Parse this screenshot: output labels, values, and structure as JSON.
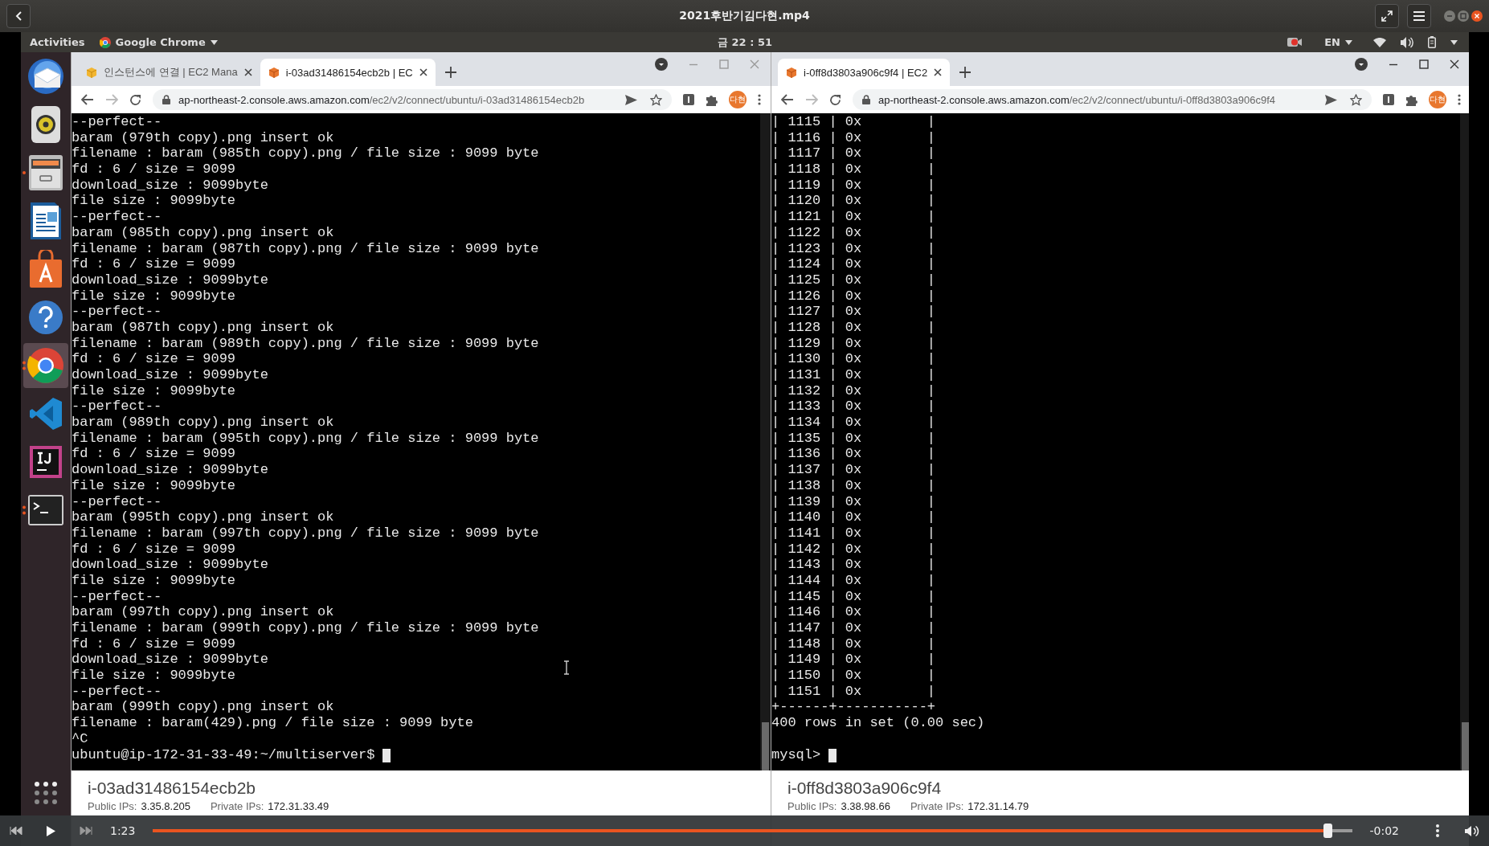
{
  "player": {
    "title": "2021후반기김다현.mp4",
    "elapsed": "1:23",
    "remaining": "-0:02",
    "progress": {
      "level": 0.98
    }
  },
  "topbar": {
    "activities": "Activities",
    "app": "Google Chrome",
    "clock": "금 22 : 51",
    "language": "EN"
  },
  "dock": [
    {
      "kind": "mail",
      "running": false,
      "selected": false
    },
    {
      "kind": "speaker",
      "running": false,
      "selected": false
    },
    {
      "kind": "files",
      "running": true,
      "multiple": false,
      "selected": false
    },
    {
      "kind": "writer",
      "running": false,
      "selected": false
    },
    {
      "kind": "store",
      "running": false,
      "selected": false
    },
    {
      "kind": "help",
      "running": false,
      "selected": false
    },
    {
      "kind": "browser",
      "running": true,
      "multiple": true,
      "selected": true
    },
    {
      "kind": "code",
      "running": false,
      "selected": false
    },
    {
      "kind": "ide",
      "running": false,
      "selected": false
    },
    {
      "kind": "terminal",
      "running": true,
      "multiple": true,
      "selected": false
    },
    {
      "kind": "apps",
      "running": false,
      "selected": false
    }
  ],
  "windows": [
    {
      "active": false,
      "tabs": [
        {
          "title": "인스턴스에 연결 | EC2 Mana",
          "kind": "console",
          "selected": false
        },
        {
          "title": "i-03ad31486154ecb2b | EC",
          "kind": "instance",
          "selected": true
        }
      ],
      "url_host": "ap-northeast-2.console.aws.amazon.com",
      "url_path": "/ec2/v2/connect/ubuntu/i-03ad31486154ecb2b",
      "avatar": "다현",
      "terminal": {
        "lines": [
          "--perfect--",
          "baram (979th copy).png insert ok",
          "filename : baram (985th copy).png / file size : 9099 byte",
          "fd : 6 / size = 9099",
          "download_size : 9099byte",
          "file size : 9099byte",
          "--perfect--",
          "baram (985th copy).png insert ok",
          "filename : baram (987th copy).png / file size : 9099 byte",
          "fd : 6 / size = 9099",
          "download_size : 9099byte",
          "file size : 9099byte",
          "--perfect--",
          "baram (987th copy).png insert ok",
          "filename : baram (989th copy).png / file size : 9099 byte",
          "fd : 6 / size = 9099",
          "download_size : 9099byte",
          "file size : 9099byte",
          "--perfect--",
          "baram (989th copy).png insert ok",
          "filename : baram (995th copy).png / file size : 9099 byte",
          "fd : 6 / size = 9099",
          "download_size : 9099byte",
          "file size : 9099byte",
          "--perfect--",
          "baram (995th copy).png insert ok",
          "filename : baram (997th copy).png / file size : 9099 byte",
          "fd : 6 / size = 9099",
          "download_size : 9099byte",
          "file size : 9099byte",
          "--perfect--",
          "baram (997th copy).png insert ok",
          "filename : baram (999th copy).png / file size : 9099 byte",
          "fd : 6 / size = 9099",
          "download_size : 9099byte",
          "file size : 9099byte",
          "--perfect--",
          "baram (999th copy).png insert ok",
          "filename : baram(429).png / file size : 9099 byte",
          "^C"
        ],
        "prompt": "ubuntu@ip-172-31-33-49:~/multiserver$"
      },
      "instance_id": "i-03ad31486154ecb2b",
      "public_label": "Public IPs:",
      "public_ip": "3.35.8.205",
      "private_label": "Private IPs:",
      "private_ip": "172.31.33.49"
    },
    {
      "active": true,
      "tabs": [
        {
          "title": "i-0ff8d3803a906c9f4 | EC2",
          "kind": "instance",
          "selected": true
        }
      ],
      "url_host": "ap-northeast-2.console.aws.amazon.com",
      "url_path": "/ec2/v2/connect/ubuntu/i-0ff8d3803a906c9f4",
      "avatar": "다현",
      "terminal": {
        "lines": [
          "| 1115 | 0x        |",
          "| 1116 | 0x        |",
          "| 1117 | 0x        |",
          "| 1118 | 0x        |",
          "| 1119 | 0x        |",
          "| 1120 | 0x        |",
          "| 1121 | 0x        |",
          "| 1122 | 0x        |",
          "| 1123 | 0x        |",
          "| 1124 | 0x        |",
          "| 1125 | 0x        |",
          "| 1126 | 0x        |",
          "| 1127 | 0x        |",
          "| 1128 | 0x        |",
          "| 1129 | 0x        |",
          "| 1130 | 0x        |",
          "| 1131 | 0x        |",
          "| 1132 | 0x        |",
          "| 1133 | 0x        |",
          "| 1134 | 0x        |",
          "| 1135 | 0x        |",
          "| 1136 | 0x        |",
          "| 1137 | 0x        |",
          "| 1138 | 0x        |",
          "| 1139 | 0x        |",
          "| 1140 | 0x        |",
          "| 1141 | 0x        |",
          "| 1142 | 0x        |",
          "| 1143 | 0x        |",
          "| 1144 | 0x        |",
          "| 1145 | 0x        |",
          "| 1146 | 0x        |",
          "| 1147 | 0x        |",
          "| 1148 | 0x        |",
          "| 1149 | 0x        |",
          "| 1150 | 0x        |",
          "| 1151 | 0x        |",
          "+------+-----------+",
          "400 rows in set (0.00 sec)"
        ],
        "prompt": "mysql>"
      },
      "instance_id": "i-0ff8d3803a906c9f4",
      "public_label": "Public IPs:",
      "public_ip": "3.38.98.66",
      "private_label": "Private IPs:",
      "private_ip": "172.31.14.79"
    }
  ]
}
